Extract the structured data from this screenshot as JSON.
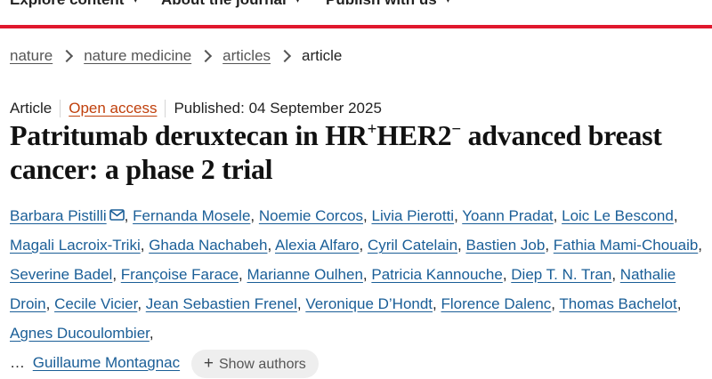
{
  "nav": {
    "items": [
      {
        "label": "Explore content"
      },
      {
        "label": "About the journal"
      },
      {
        "label": "Publish with us"
      }
    ]
  },
  "breadcrumb": {
    "items": [
      "nature",
      "nature medicine",
      "articles"
    ],
    "current": "article"
  },
  "meta": {
    "type": "Article",
    "access": "Open access",
    "published": "Published: 04 September 2025"
  },
  "title": {
    "part1": "Patritumab deruxtecan in HR",
    "sup1": "+",
    "part2": "HER2",
    "sup2": "−",
    "part3": " advanced breast cancer: a phase 2 trial"
  },
  "authors": {
    "list": [
      "Barbara Pistilli",
      "Fernanda Mosele",
      "Noemie Corcos",
      "Livia Pierotti",
      "Yoann Pradat",
      "Loic Le Bescond",
      "Magali Lacroix-Triki",
      "Ghada Nachabeh",
      "Alexia Alfaro",
      "Cyril Catelain",
      "Bastien Job",
      "Fathia Mami-Chouaib",
      "Severine Badel",
      "Françoise Farace",
      "Marianne Oulhen",
      "Patricia Kannouche",
      "Diep T. N. Tran",
      "Nathalie Droin",
      "Cecile Vicier",
      "Jean Sebastien Frenel",
      "Veronique D’Hondt",
      "Florence Dalenc",
      "Thomas Bachelot",
      "Agnes Ducoulombier"
    ],
    "ellipsis": "…",
    "last": "Guillaume Montagnac",
    "show_label": "Show authors"
  },
  "colors": {
    "accent_red": "#e0182d",
    "author_link": "#1a5e97",
    "open_access": "#c0400c"
  },
  "icons": [
    "mail-icon",
    "chevron-down-icon",
    "chevron-right-icon",
    "plus-icon"
  ]
}
